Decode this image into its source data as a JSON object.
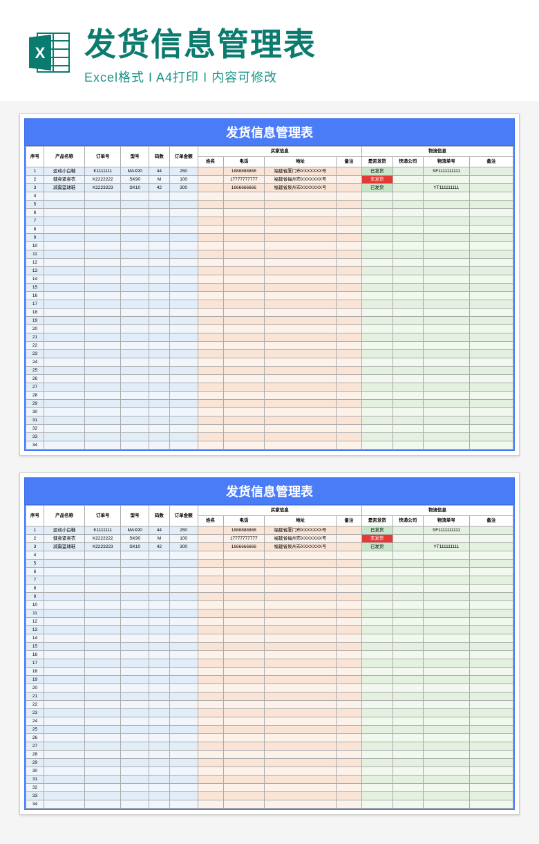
{
  "banner": {
    "title": "发货信息管理表",
    "sub_format": "Excel格式",
    "sub_print": "A4打印",
    "sub_edit": "内容可修改"
  },
  "sheet": {
    "title": "发货信息管理表",
    "columns": {
      "idx": "序号",
      "product": "产品名称",
      "order": "订单号",
      "model": "型号",
      "qty": "码数",
      "amount": "订单金额",
      "buyer_group": "买家信息",
      "name": "姓名",
      "phone": "电话",
      "address": "地址",
      "note1": "备注",
      "logistics_group": "物流信息",
      "shipped": "是否发货",
      "express": "快递公司",
      "tracking": "物流单号",
      "note2": "备注"
    },
    "status": {
      "shipped": "已发货",
      "unshipped": "未发货"
    },
    "rows": [
      {
        "idx": 1,
        "product": "运动小白鞋",
        "order": "K1111111",
        "model": "MAX90",
        "qty": "44",
        "amount": "250",
        "name": "",
        "phone": "1888888888",
        "address": "福建省厦门市XXXXXXX号",
        "note1": "",
        "shipped": "已发货",
        "express": "",
        "tracking": "SF1111111111",
        "note2": ""
      },
      {
        "idx": 2,
        "product": "健身紧身衣",
        "order": "K2222222",
        "model": "SK90",
        "qty": "M",
        "amount": "100",
        "name": "",
        "phone": "17777777777",
        "address": "福建省福州市XXXXXXX号",
        "note1": "",
        "shipped": "未发货",
        "express": "",
        "tracking": "",
        "note2": ""
      },
      {
        "idx": 3,
        "product": "减震篮球鞋",
        "order": "K2223223",
        "model": "SK10",
        "qty": "42",
        "amount": "300",
        "name": "",
        "phone": "1666666666",
        "address": "福建省泉州市XXXXXXX号",
        "note1": "",
        "shipped": "已发货",
        "express": "",
        "tracking": "YT111111111",
        "note2": ""
      }
    ],
    "total_rows": 34
  }
}
